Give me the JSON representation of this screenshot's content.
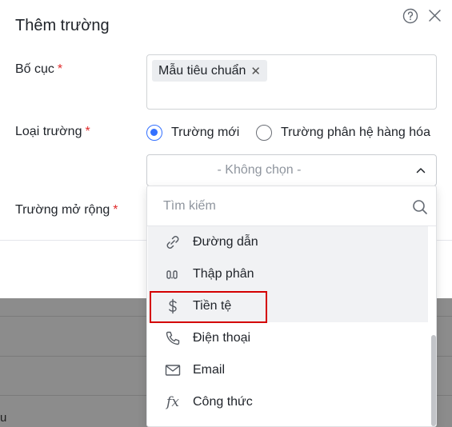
{
  "background": {
    "text": "u"
  },
  "modal": {
    "title": "Thêm trường",
    "help_icon": "question-circle-icon",
    "close_icon": "close-icon"
  },
  "form": {
    "layout": {
      "label": "Bố cục",
      "required": "*",
      "tag": "Mẫu tiêu chuẩn",
      "tag_remove": "✕"
    },
    "field_type": {
      "label": "Loại trường",
      "required": "*",
      "options": [
        {
          "label": "Trường mới",
          "selected": true
        },
        {
          "label": "Trường phân hệ hàng hóa",
          "selected": false
        }
      ],
      "select_value": "- Không chọn -"
    },
    "extended_field": {
      "label": "Trường mở rộng",
      "required": "*"
    }
  },
  "dropdown": {
    "search_placeholder": "Tìm kiếm",
    "items": [
      {
        "label": "Đường dẫn",
        "icon": "link-icon"
      },
      {
        "label": "Thập phân",
        "icon": "decimal-icon"
      },
      {
        "label": "Tiền tệ",
        "icon": "dollar-icon",
        "highlighted": true
      },
      {
        "label": "Điện thoại",
        "icon": "phone-icon"
      },
      {
        "label": "Email",
        "icon": "mail-icon"
      },
      {
        "label": "Công thức",
        "icon": "formula-icon",
        "glyph": "fx"
      }
    ]
  },
  "colors": {
    "accent": "#3370ff",
    "required": "#e02b2b",
    "selection_outline": "#d40000"
  }
}
